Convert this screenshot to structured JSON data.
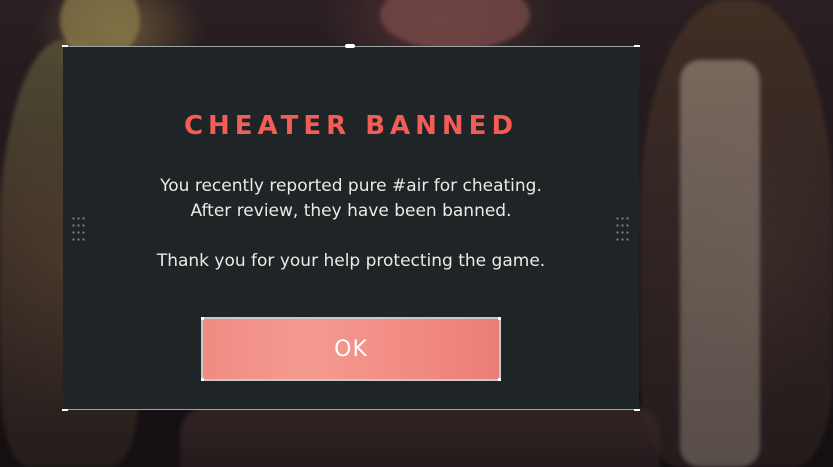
{
  "dialog": {
    "title": "CHEATER BANNED",
    "message_line_1": "You recently reported pure #air for cheating.",
    "message_line_2": "After review, they have been banned.",
    "message_line_3": "Thank you for your help protecting the game.",
    "ok_label": "OK"
  },
  "colors": {
    "title_accent": "#f25d56",
    "button_fill": "#f28b82",
    "dialog_background": "#1f2426",
    "message_text": "#eceae4"
  }
}
